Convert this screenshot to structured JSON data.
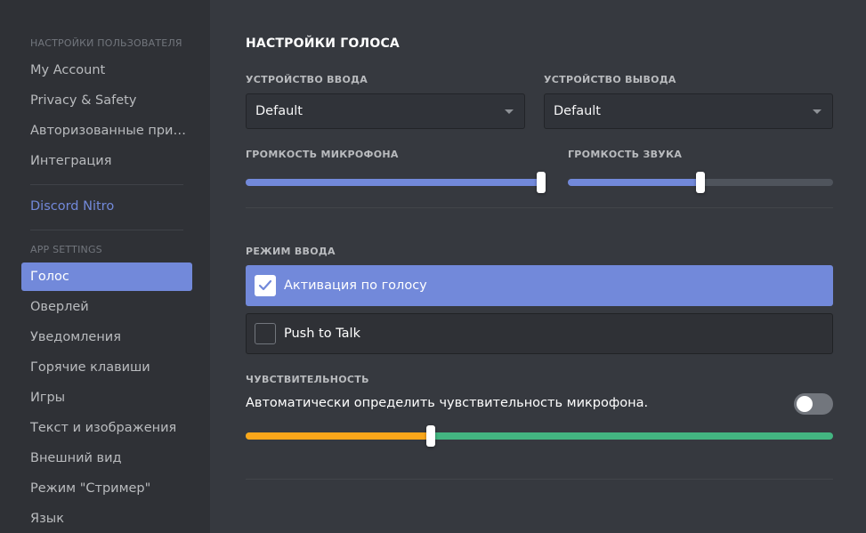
{
  "sidebar": {
    "user_settings_header": "НАСТРОЙКИ ПОЛЬЗОВАТЕЛЯ",
    "user_items": [
      "My Account",
      "Privacy & Safety",
      "Авторизованные прил...",
      "Интеграция"
    ],
    "nitro_label": "Discord Nitro",
    "app_settings_header": "APP SETTINGS",
    "app_items": [
      "Голос",
      "Оверлей",
      "Уведомления",
      "Горячие клавиши",
      "Игры",
      "Текст и изображения",
      "Внешний вид",
      "Режим \"Стример\"",
      "Язык"
    ],
    "active_item": "Голос"
  },
  "voice": {
    "title": "НАСТРОЙКИ ГОЛОСА",
    "input_device_label": "УСТРОЙСТВО ВВОДА",
    "input_device_value": "Default",
    "output_device_label": "УСТРОЙСТВО ВЫВОДА",
    "output_device_value": "Default",
    "mic_volume_label": "ГРОМКОСТЬ МИКРОФОНА",
    "mic_volume_level": 1.0,
    "sound_volume_label": "ГРОМКОСТЬ ЗВУКА",
    "sound_volume_level": 0.5
  },
  "input_mode": {
    "label": "РЕЖИМ ВВОДА",
    "options": [
      "Активация по голосу",
      "Push to Talk"
    ],
    "selected": "Активация по голосу"
  },
  "sensitivity": {
    "label": "ЧУВСТВИТЕЛЬНОСТЬ",
    "auto_text": "Автоматически определить чувствительность микрофона.",
    "auto_enabled": false,
    "threshold_level": 0.315
  },
  "colors": {
    "accent": "#7289da",
    "warn": "#faa61a",
    "ok": "#43b581"
  },
  "icons": {
    "check": "checkmark-icon",
    "caret": "chevron-down-icon"
  }
}
